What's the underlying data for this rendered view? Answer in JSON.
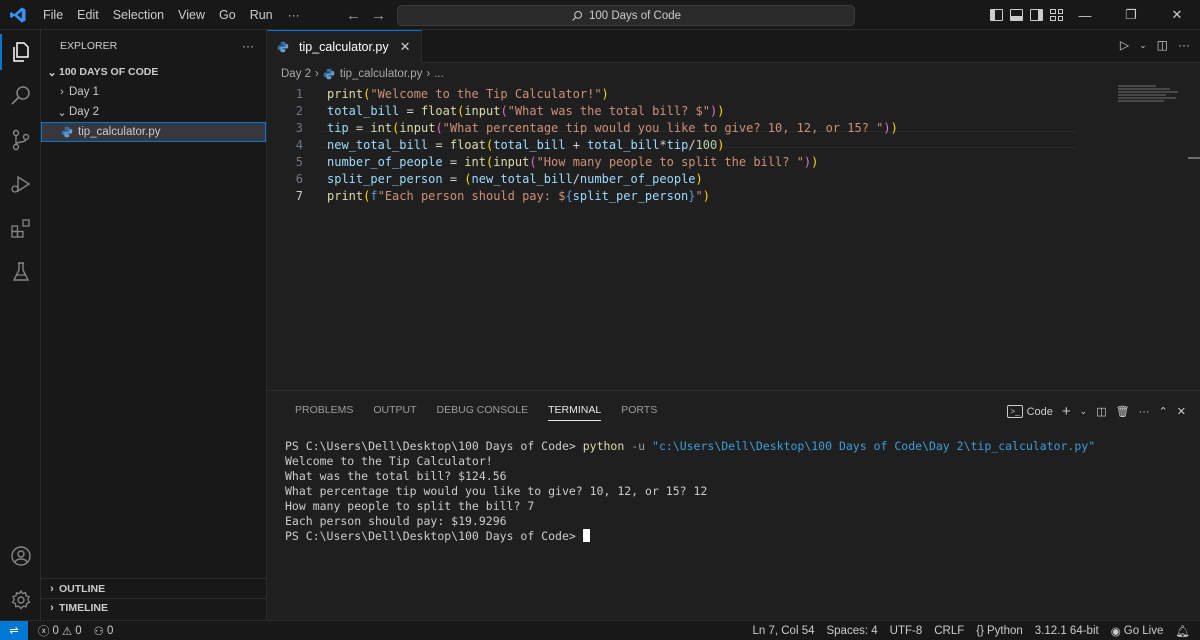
{
  "titlebar": {
    "menu": [
      "File",
      "Edit",
      "Selection",
      "View",
      "Go",
      "Run"
    ],
    "more": "···",
    "search_text": "100 Days of Code",
    "back_icon": "arrow-left-icon",
    "forward_icon": "arrow-right-icon"
  },
  "sidebar": {
    "title": "EXPLORER",
    "more": "···",
    "root": "100 DAYS OF CODE",
    "items": [
      {
        "label": "Day 1",
        "expanded": false
      },
      {
        "label": "Day 2",
        "expanded": true
      },
      {
        "label": "tip_calculator.py",
        "selected": true
      }
    ],
    "outline": "OUTLINE",
    "timeline": "TIMELINE"
  },
  "editor": {
    "tab_label": "tip_calculator.py",
    "tab_close": "✕",
    "breadcrumb": [
      "Day 2",
      "tip_calculator.py",
      "..."
    ],
    "current_line": 7,
    "lines": [
      "print(\"Welcome to the Tip Calculator!\")",
      "total_bill = float(input(\"What was the total bill? $\"))",
      "tip = int(input(\"What percentage tip would you like to give? 10, 12, or 15? \"))",
      "new_total_bill = float(total_bill + total_bill*tip/100)",
      "number_of_people = int(input(\"How many people to split the bill? \"))",
      "split_per_person = (new_total_bill/number_of_people)",
      "print(f\"Each person should pay: ${split_per_person}\")"
    ],
    "line_numbers": [
      "1",
      "2",
      "3",
      "4",
      "5",
      "6",
      "7"
    ]
  },
  "panel": {
    "tabs": [
      "PROBLEMS",
      "OUTPUT",
      "DEBUG CONSOLE",
      "TERMINAL",
      "PORTS"
    ],
    "active_tab": "TERMINAL",
    "terminal_profile": "Code",
    "terminal": {
      "prompt": "PS C:\\Users\\Dell\\Desktop\\100 Days of Code>",
      "command": "python",
      "flag": "-u",
      "arg": "\"c:\\Users\\Dell\\Desktop\\100 Days of Code\\Day 2\\tip_calculator.py\"",
      "output": [
        "Welcome to the Tip Calculator!",
        "What was the total bill? $124.56",
        "What percentage tip would you like to give? 10, 12, or 15? 12",
        "How many people to split the bill? 7",
        "Each person should pay: $19.9296"
      ],
      "final_prompt": "PS C:\\Users\\Dell\\Desktop\\100 Days of Code>"
    }
  },
  "statusbar": {
    "errors": "0",
    "warnings": "0",
    "ports": "0",
    "position": "Ln 7, Col 54",
    "spaces": "Spaces: 4",
    "encoding": "UTF-8",
    "eol": "CRLF",
    "language": "Python",
    "interpreter": "3.12.1 64-bit",
    "golive": "Go Live"
  },
  "colors": {
    "accent": "#0078d4",
    "background": "#1f1f1f",
    "sidebar": "#181818"
  }
}
